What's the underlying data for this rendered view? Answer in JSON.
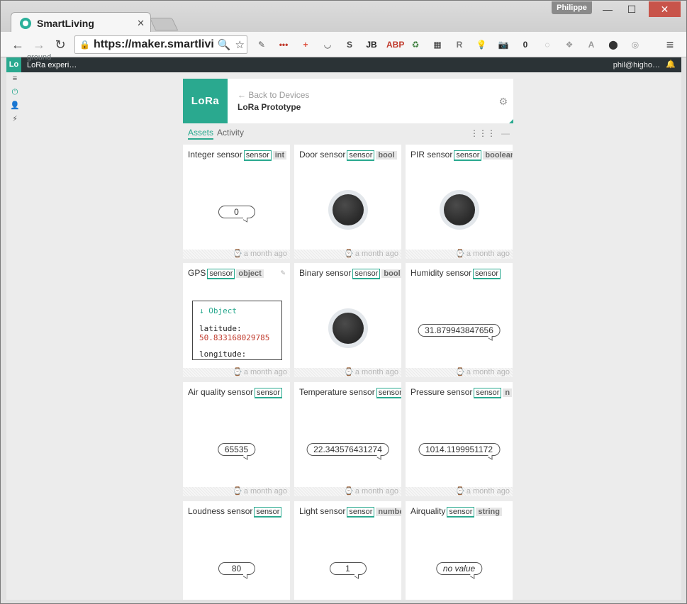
{
  "browser": {
    "tab_title": "SmartLiving",
    "tab_close": "✕",
    "profile": "Philippe",
    "url": "https://maker.smartlivi",
    "window_min": "—",
    "window_max": "☐",
    "window_close": "✕",
    "back": "←",
    "forward": "→",
    "reload": "↻",
    "lock": "🔒",
    "zoom_icon": "🔍",
    "star_icon": "☆",
    "extensions": [
      {
        "name": "pin-extension-icon",
        "glyph": "✎",
        "color": "#555555"
      },
      {
        "name": "lastpass-extension-icon",
        "glyph": "•••",
        "color": "#c0392b"
      },
      {
        "name": "google-plus-extension-icon",
        "glyph": "+",
        "color": "#dd4b39"
      },
      {
        "name": "pocket-extension-icon",
        "glyph": "◡",
        "color": "#333333"
      },
      {
        "name": "s-extension-icon",
        "glyph": "S",
        "color": "#444444"
      },
      {
        "name": "jb-extension-icon",
        "glyph": "JB",
        "color": "#222222"
      },
      {
        "name": "abp-extension-icon",
        "glyph": "ABP",
        "color": "#c0392b"
      },
      {
        "name": "recycle-extension-icon",
        "glyph": "♻",
        "color": "#3a7d3a"
      },
      {
        "name": "qr-extension-icon",
        "glyph": "▦",
        "color": "#333333"
      },
      {
        "name": "r-extension-icon",
        "glyph": "R",
        "color": "#777777"
      },
      {
        "name": "bulb-extension-icon",
        "glyph": "💡",
        "color": "#777777"
      },
      {
        "name": "camera-extension-icon",
        "glyph": "📷",
        "color": "#999999"
      },
      {
        "name": "zero-extension-icon",
        "glyph": "0",
        "color": "#333333"
      },
      {
        "name": "ring-extension-icon",
        "glyph": "◌",
        "color": "#999999"
      },
      {
        "name": "dropbox-extension-icon",
        "glyph": "❖",
        "color": "#999999"
      },
      {
        "name": "angular-extension-icon",
        "glyph": "A",
        "color": "#999999"
      },
      {
        "name": "shield-extension-icon",
        "glyph": "⬤",
        "color": "#333333"
      },
      {
        "name": "circle-extension-icon",
        "glyph": "◎",
        "color": "#999999"
      }
    ],
    "menu": "≡"
  },
  "app": {
    "badge": "Lo",
    "ground_label": "ground",
    "project_name": "LoRa experi…",
    "user": "phil@higho…",
    "bell": "🔔"
  },
  "leftnav": [
    {
      "name": "menu-icon",
      "glyph": "≡"
    },
    {
      "name": "plug-icon",
      "glyph": "⏻"
    },
    {
      "name": "user-icon",
      "glyph": "👤"
    },
    {
      "name": "bolt-icon",
      "glyph": "⚡"
    }
  ],
  "device": {
    "logo_text": "LoRa",
    "back_link": "← Back to Devices",
    "name": "LoRa Prototype",
    "settings_icon": "⚙"
  },
  "tabs": {
    "assets": "Assets",
    "activity": "Activity",
    "grid_icon": "⋮⋮⋮",
    "list_icon": "—"
  },
  "cards": [
    {
      "title": "Integer sensor",
      "tag": "sensor",
      "type": "int",
      "kind": "value",
      "value": "0",
      "footer": "a month ago"
    },
    {
      "title": "Door sensor",
      "tag": "sensor",
      "type": "bool",
      "kind": "led",
      "footer": "a month ago"
    },
    {
      "title": "PIR sensor",
      "tag": "sensor",
      "type": "boolean",
      "kind": "led",
      "footer": "a month ago"
    },
    {
      "title": "GPS",
      "tag": "sensor",
      "type": "object",
      "kind": "object",
      "object_head": "Object",
      "object_key1": "latitude:",
      "object_val1": "50.833168029785",
      "object_key2": "longitude:",
      "footer": "a month ago"
    },
    {
      "title": "Binary sensor",
      "tag": "sensor",
      "type": "bool",
      "kind": "led",
      "footer": "a month ago"
    },
    {
      "title": "Humidity sensor",
      "tag": "sensor",
      "type": "",
      "kind": "value",
      "value": "31.879943847656",
      "footer": "a month ago"
    },
    {
      "title": "Air quality sensor",
      "tag": "sensor",
      "type": "",
      "kind": "value",
      "value": "65535",
      "footer": "a month ago"
    },
    {
      "title": "Temperature sensor",
      "tag": "sensor",
      "type": "",
      "kind": "value",
      "value": "22.343576431274",
      "footer": "a month ago"
    },
    {
      "title": "Pressure sensor",
      "tag": "sensor",
      "type": "n",
      "kind": "value",
      "value": "1014.1199951172",
      "footer": "a month ago"
    },
    {
      "title": "Loudness sensor",
      "tag": "sensor",
      "type": "",
      "kind": "value",
      "value": "80",
      "footer": ""
    },
    {
      "title": "Light sensor",
      "tag": "sensor",
      "type": "number",
      "kind": "value",
      "value": "1",
      "footer": ""
    },
    {
      "title": "Airquality",
      "tag": "sensor",
      "type": "string",
      "kind": "novalue",
      "value": "no value",
      "footer": ""
    }
  ],
  "footer_clock_icon": "⌚"
}
